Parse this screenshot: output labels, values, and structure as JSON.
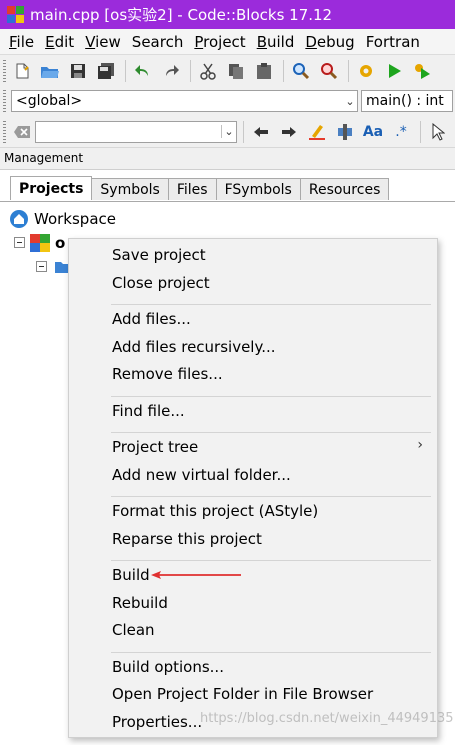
{
  "window": {
    "title": "main.cpp [os实验2] - Code::Blocks 17.12"
  },
  "menubar": [
    {
      "label": "File",
      "mnemonic": "F",
      "rest": "ile"
    },
    {
      "label": "Edit",
      "mnemonic": "E",
      "rest": "dit"
    },
    {
      "label": "View",
      "mnemonic": "V",
      "rest": "iew"
    },
    {
      "label": "Search",
      "mnemonic": "",
      "rest": "Search"
    },
    {
      "label": "Project",
      "mnemonic": "P",
      "rest": "roject"
    },
    {
      "label": "Build",
      "mnemonic": "B",
      "rest": "uild"
    },
    {
      "label": "Debug",
      "mnemonic": "D",
      "rest": "ebug"
    },
    {
      "label": "Fortran",
      "mnemonic": "",
      "rest": "Fortran"
    }
  ],
  "codebar": {
    "scope": "<global>",
    "function": "main() : int"
  },
  "searchbar": {
    "text": "",
    "regex_label": "Aa",
    "regex2": ".*"
  },
  "management": {
    "label": "Management",
    "tabs": [
      "Projects",
      "Symbols",
      "Files",
      "FSymbols",
      "Resources"
    ],
    "active_tab": "Projects",
    "tree": {
      "workspace": "Workspace",
      "project_partial": "o"
    }
  },
  "context_menu": {
    "groups": [
      [
        "Save project",
        "Close project"
      ],
      [
        "Add files...",
        "Add files recursively...",
        "Remove files..."
      ],
      [
        "Find file..."
      ],
      [
        "Project tree",
        "Add new virtual folder..."
      ],
      [
        "Format this project (AStyle)",
        "Reparse this project"
      ],
      [
        "Build",
        "Rebuild",
        "Clean"
      ],
      [
        "Build options...",
        "Open Project Folder in File Browser",
        "Properties..."
      ]
    ],
    "submenu_item": "Project tree",
    "highlighted_item": "Build",
    "arrow_color": "#e03030"
  },
  "watermark": "https://blog.csdn.net/weixin_44949135",
  "colors": {
    "titlebar": "#9b2bdb"
  }
}
